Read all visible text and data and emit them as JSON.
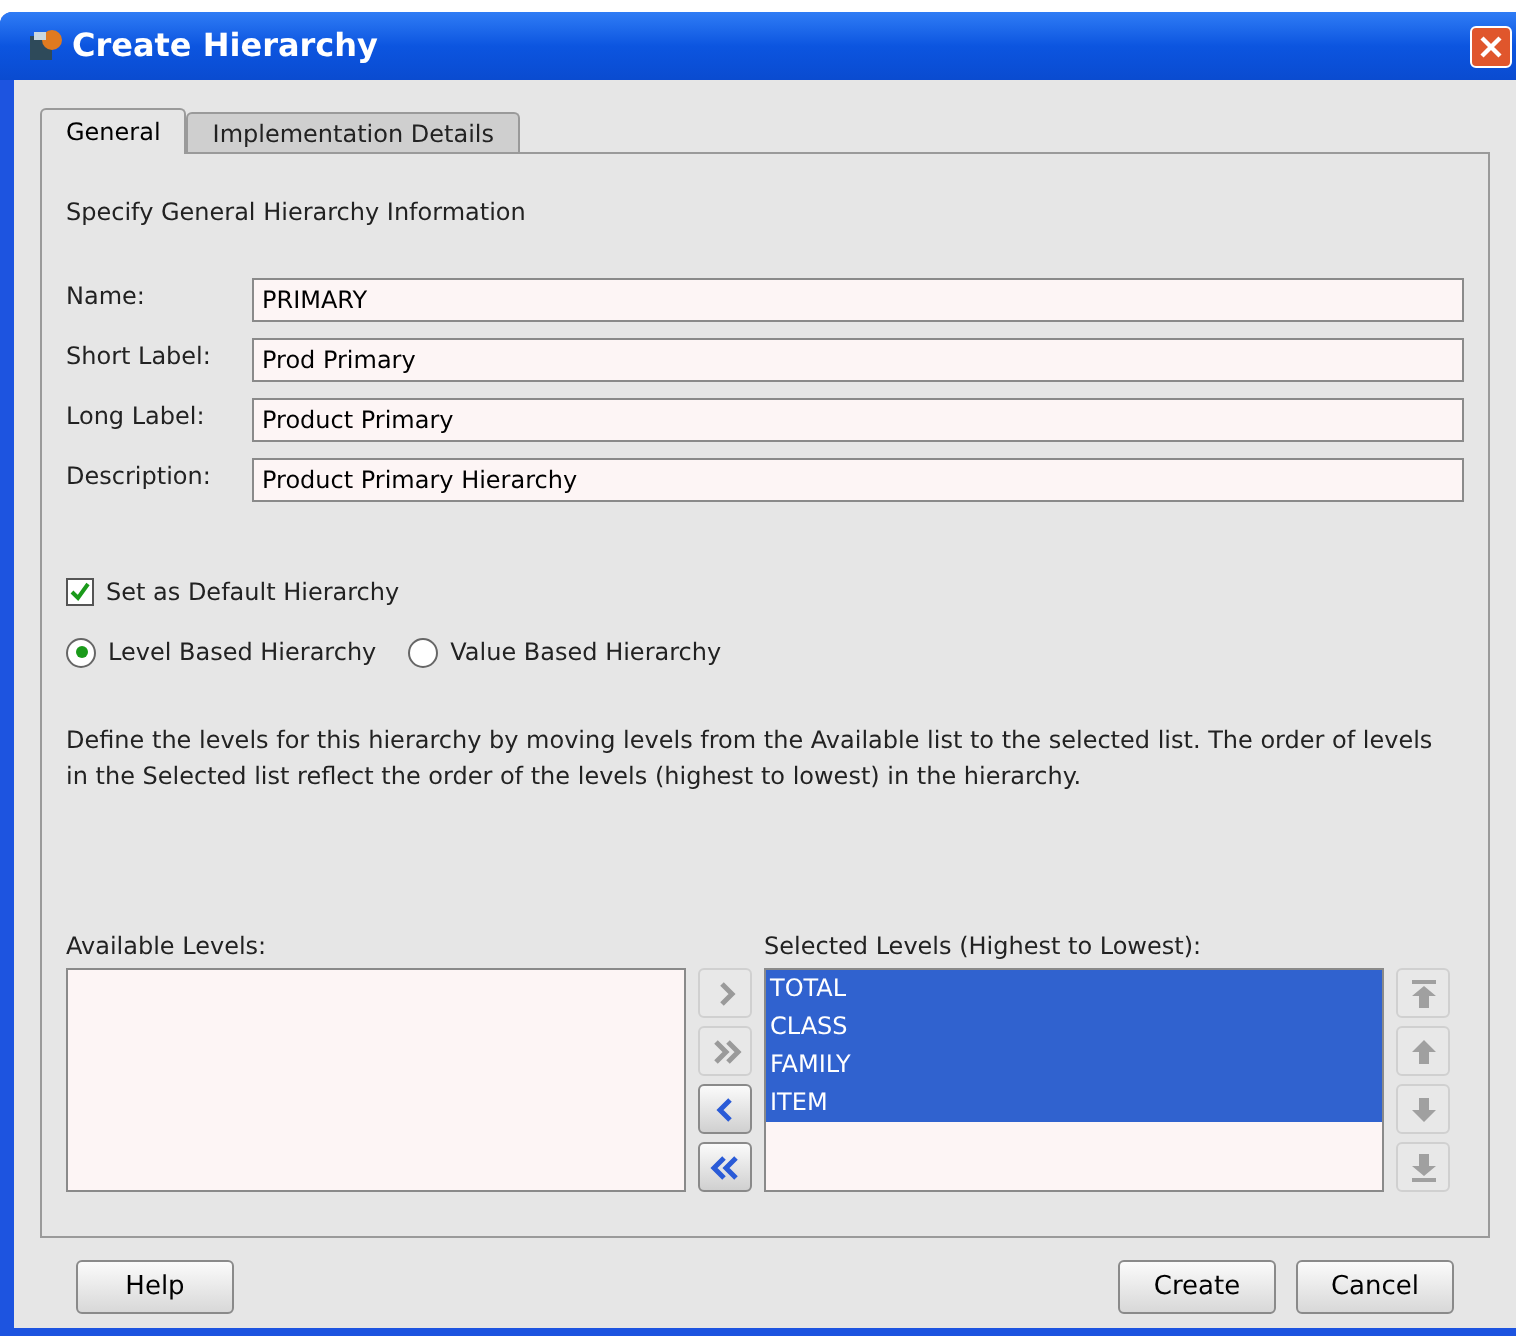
{
  "window": {
    "title": "Create Hierarchy"
  },
  "tabs": [
    {
      "label": "General",
      "selected": true
    },
    {
      "label": "Implementation Details",
      "selected": false
    }
  ],
  "heading": "Specify General Hierarchy Information",
  "fields": [
    {
      "label": "Name:",
      "value": "PRIMARY"
    },
    {
      "label": "Short Label:",
      "value": "Prod Primary"
    },
    {
      "label": "Long Label:",
      "value": "Product Primary"
    },
    {
      "label": "Description:",
      "value": "Product Primary Hierarchy"
    }
  ],
  "default_checkbox": {
    "label": "Set as Default Hierarchy",
    "checked": true
  },
  "radios": [
    {
      "label": "Level Based Hierarchy",
      "selected": true
    },
    {
      "label": "Value Based Hierarchy",
      "selected": false
    }
  ],
  "instructions": "Define the levels for this hierarchy by moving levels from the Available list to the selected list. The order of levels in the Selected list reflect the order of the levels (highest to lowest) in the hierarchy.",
  "available": {
    "label": "Available Levels:"
  },
  "move_buttons": [
    {
      "kind": "add",
      "disabled": true
    },
    {
      "kind": "add_all",
      "disabled": true
    },
    {
      "kind": "remove",
      "disabled": false
    },
    {
      "kind": "remove_all",
      "disabled": false
    }
  ],
  "selected_levels": {
    "label": "Selected Levels (Highest to Lowest):",
    "items": [
      {
        "label": "TOTAL",
        "selected": true
      },
      {
        "label": "CLASS",
        "selected": true
      },
      {
        "label": "FAMILY",
        "selected": true
      },
      {
        "label": "ITEM",
        "selected": true
      }
    ]
  },
  "order_buttons": [
    {
      "kind": "top",
      "disabled": true
    },
    {
      "kind": "up",
      "disabled": true
    },
    {
      "kind": "down",
      "disabled": true
    },
    {
      "kind": "bottom",
      "disabled": true
    }
  ],
  "buttons": {
    "help": "Help",
    "create": "Create",
    "cancel": "Cancel"
  }
}
